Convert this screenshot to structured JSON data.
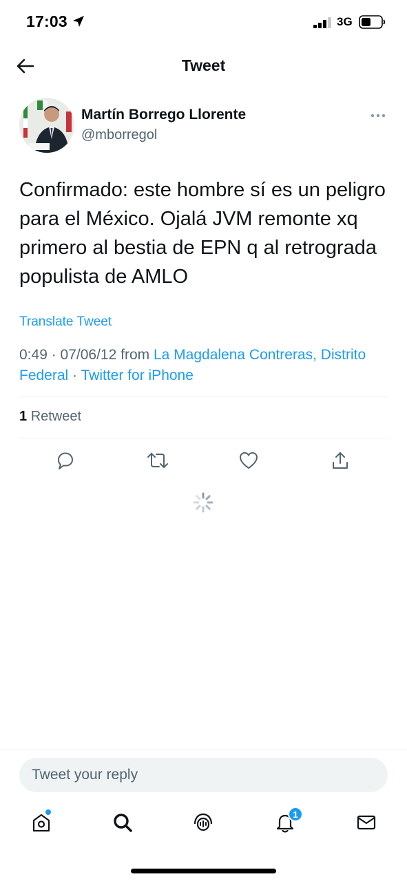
{
  "status_bar": {
    "time": "17:03",
    "network": "3G"
  },
  "nav": {
    "title": "Tweet",
    "back_icon": "arrow-left-icon"
  },
  "tweet": {
    "author_name": "Martín Borrego Llorente",
    "author_handle": "@mborregol",
    "text": "Confirmado: este hombre sí es un peligro para el México. Ojalá JVM remonte xq primero al bestia de EPN q al retrograda populista de AMLO",
    "translate_label": "Translate Tweet",
    "time": "0:49",
    "date": "07/06/12",
    "from_label": "from",
    "location": "La Magdalena Contreras, Distrito Federal",
    "source": "Twitter for iPhone",
    "retweet_count": "1",
    "retweet_label": "Retweet"
  },
  "actions": {
    "icons": [
      "reply-icon",
      "retweet-icon",
      "like-icon",
      "share-icon"
    ]
  },
  "reply": {
    "placeholder": "Tweet your reply"
  },
  "tab_bar": {
    "icons": [
      "home-icon",
      "search-icon",
      "spaces-icon",
      "notifications-icon",
      "messages-icon"
    ],
    "notifications_badge": "1"
  },
  "colors": {
    "accent": "#1d9bf0",
    "text_primary": "#0f1419",
    "text_secondary": "#536471"
  }
}
